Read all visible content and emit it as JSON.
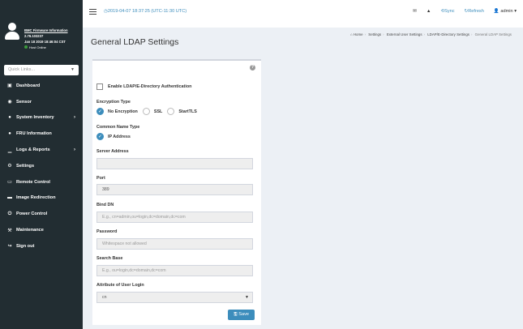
{
  "user_panel": {
    "firmware_label": "BMC Firmware Information",
    "version": "2.76.103237",
    "build_date": "Jan 18 2019 18:46:04 CST",
    "host_status": "Host Online"
  },
  "quick_links": {
    "placeholder": "Quick Links..."
  },
  "menu": [
    {
      "icon": "dashboard-icon",
      "glyph": "▣",
      "label": "Dashboard",
      "arrow": ""
    },
    {
      "icon": "sensor-icon",
      "glyph": "◉",
      "label": "Sensor",
      "arrow": ""
    },
    {
      "icon": "info-icon",
      "glyph": "●",
      "label": "System Inventory",
      "arrow": "›"
    },
    {
      "icon": "info-icon",
      "glyph": "●",
      "label": "FRU Information",
      "arrow": ""
    },
    {
      "icon": "chart-icon",
      "glyph": "▁",
      "label": "Logs & Reports",
      "arrow": "›"
    },
    {
      "icon": "gear-icon",
      "glyph": "⚙",
      "label": "Settings",
      "arrow": ""
    },
    {
      "icon": "monitor-icon",
      "glyph": "▭",
      "label": "Remote Control",
      "arrow": ""
    },
    {
      "icon": "disk-icon",
      "glyph": "▬",
      "label": "Image Redirection",
      "arrow": ""
    },
    {
      "icon": "power-icon",
      "glyph": "⏻",
      "label": "Power Control",
      "arrow": ""
    },
    {
      "icon": "wrench-icon",
      "glyph": "⚒",
      "label": "Maintenance",
      "arrow": ""
    },
    {
      "icon": "sign-out-icon",
      "glyph": "↪",
      "label": "Sign out",
      "arrow": ""
    }
  ],
  "header": {
    "datetime": "2019-04-07 18:37:25 (UTC-11:30 UTC)",
    "sync_label": "Sync",
    "refresh_label": "Refresh",
    "user_label": "admin"
  },
  "page": {
    "title": "General LDAP Settings",
    "breadcrumb": [
      "Home",
      "Settings",
      "External User Settings",
      "LDAP/E-Directory Settings",
      "General LDAP Settings"
    ]
  },
  "form": {
    "enable_label": "Enable LDAP/E-Directory Authentication",
    "encryption_type_label": "Encryption Type",
    "encryption_options": [
      "No Encryption",
      "SSL",
      "StartTLS"
    ],
    "encryption_selected": "No Encryption",
    "common_name_type_label": "Common Name Type",
    "common_name_option": "IP Address",
    "server_address_label": "Server Address",
    "server_address_value": "",
    "port_label": "Port",
    "port_value": "389",
    "bind_dn_label": "Bind DN",
    "bind_dn_placeholder": "E.g., cn=admin,ou=login,dc=domain,dc=com",
    "password_label": "Password",
    "password_placeholder": "Whitespace not allowed",
    "search_base_label": "Search Base",
    "search_base_placeholder": "E.g., ou=login,dc=domain,dc=com",
    "attribute_label": "Attribute of User Login",
    "attribute_value": "cn",
    "save_label": "Save"
  }
}
